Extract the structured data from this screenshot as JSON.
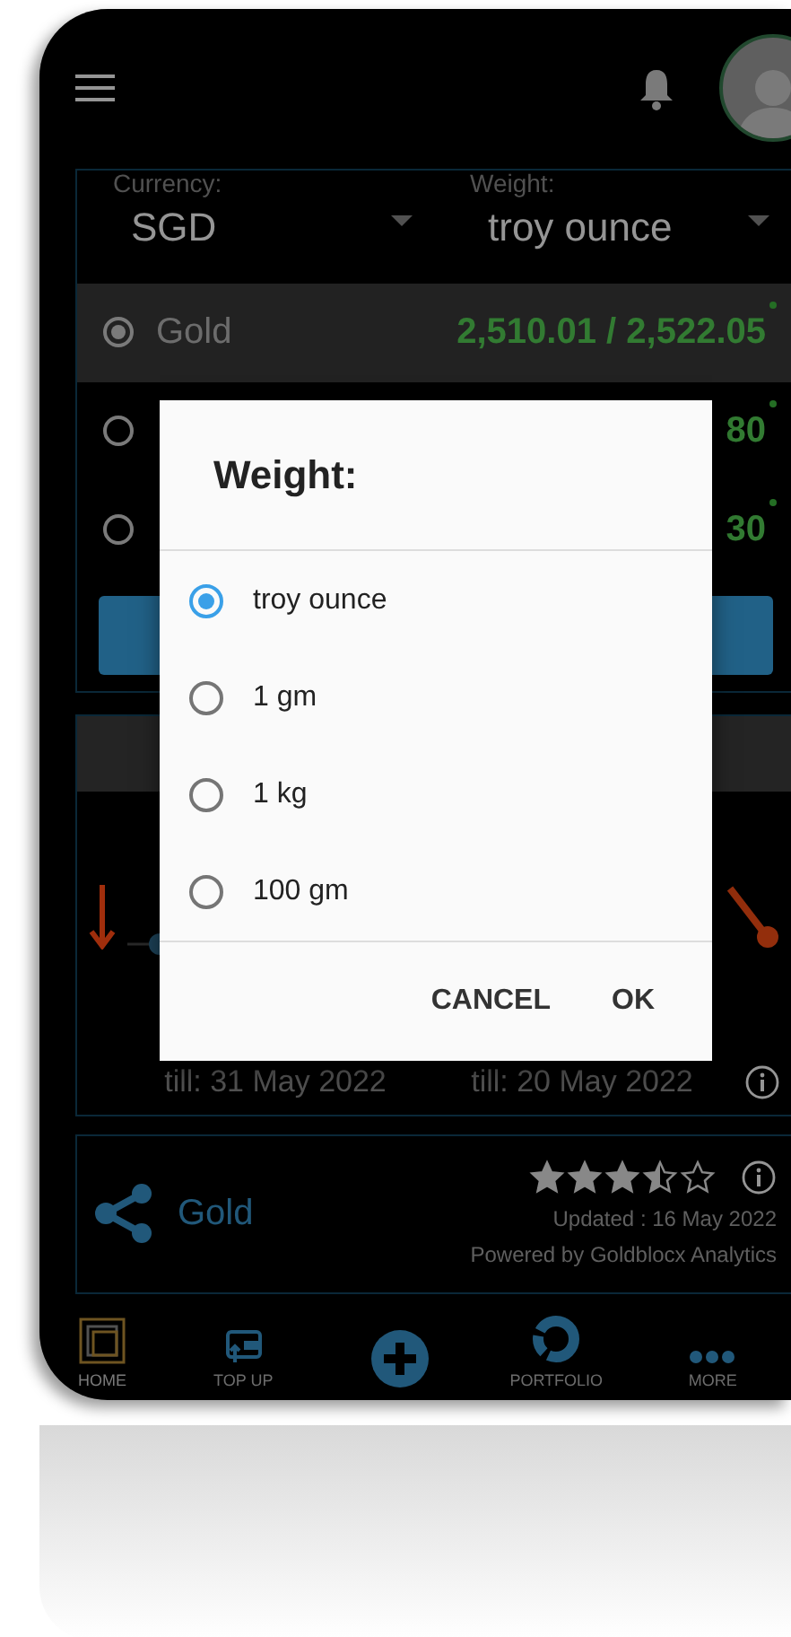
{
  "selectors": [
    {
      "label": "Currency:",
      "value": "SGD"
    },
    {
      "label": "Weight:",
      "value": "troy ounce"
    }
  ],
  "metals": [
    {
      "name": "Gold",
      "price": "2,510.01 / 2,522.05",
      "selected": true
    },
    {
      "price": "80",
      "selected": false
    },
    {
      "price": "30",
      "selected": false
    }
  ],
  "forecast": {
    "dates": [
      "till: 31 May 2022",
      "till: 20 May 2022"
    ]
  },
  "summary": {
    "stars": 3.5,
    "name": "Gold",
    "updated": "Updated : 16 May 2022",
    "powered_by": "Powered by Goldblocx Analytics"
  },
  "nav": [
    {
      "kind": "home",
      "label": "HOME",
      "selected": true
    },
    {
      "kind": "wallet",
      "label": "TOP UP",
      "selected": false
    },
    {
      "kind": "plus",
      "selected": false
    },
    {
      "kind": "portfolio",
      "label": "PORTFOLIO",
      "selected": false
    },
    {
      "kind": "more",
      "label": "MORE",
      "selected": false
    }
  ],
  "dialog": {
    "title": "Weight:",
    "options": [
      {
        "label": "troy ounce",
        "selected": true
      },
      {
        "label": "1 gm",
        "selected": false
      },
      {
        "label": "1 kg",
        "selected": false
      },
      {
        "label": "100 gm",
        "selected": false
      }
    ],
    "buttons": [
      "CANCEL",
      "OK"
    ]
  }
}
